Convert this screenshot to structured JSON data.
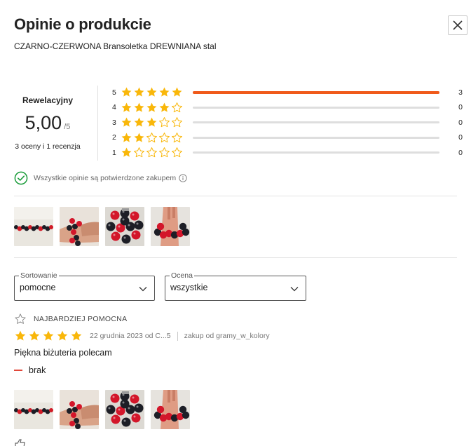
{
  "header": {
    "title": "Opinie o produkcie",
    "product_name": "CZARNO-CZERWONA Bransoletka DREWNIANA stal",
    "close_icon": "close-icon"
  },
  "summary": {
    "label": "Rewelacyjny",
    "score": "5,00",
    "score_max": "/5",
    "counts": "3 oceny i 1 recenzja"
  },
  "histogram": [
    {
      "stars": "5",
      "count": "3",
      "fraction": 1.0
    },
    {
      "stars": "4",
      "count": "0",
      "fraction": 0
    },
    {
      "stars": "3",
      "count": "0",
      "fraction": 0
    },
    {
      "stars": "2",
      "count": "0",
      "fraction": 0
    },
    {
      "stars": "1",
      "count": "0",
      "fraction": 0
    }
  ],
  "verified": {
    "text": "Wszystkie opinie są potwierdzone zakupem",
    "icon": "check-circle-icon",
    "info_icon": "info-icon"
  },
  "gallery": [
    "photo-bracelet-flat",
    "photo-bracelet-worn",
    "photo-bracelet-closeup",
    "photo-bracelet-hand"
  ],
  "filters": {
    "sort": {
      "legend": "Sortowanie",
      "value": "pomocne"
    },
    "rating": {
      "legend": "Ocena",
      "value": "wszystkie"
    }
  },
  "review": {
    "badge": "NAJBARDZIEJ POMOCNA",
    "badge_icon": "star-outline-icon",
    "rating": 5,
    "date_author": "22 grudnia 2023 od C...5",
    "purchase": "zakup od gramy_w_kolory",
    "text": "Piękna biżuteria polecam",
    "cons": "brak",
    "photos": [
      "photo-bracelet-flat",
      "photo-bracelet-worn",
      "photo-bracelet-closeup",
      "photo-bracelet-hand"
    ]
  },
  "colors": {
    "star": "#f9b70a",
    "star_empty_stroke": "#f9b70a",
    "bar_fill": "#f05a1a",
    "verified_green": "#1a9c3a",
    "cons_red": "#e1473a"
  }
}
